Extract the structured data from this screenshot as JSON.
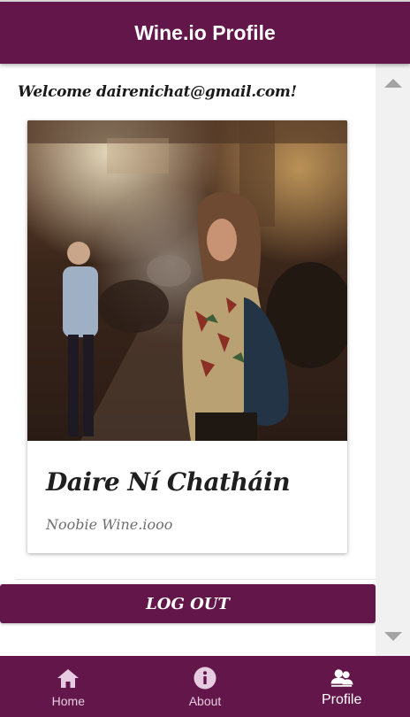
{
  "app_bar": {
    "title": "Wine.io Profile"
  },
  "welcome": {
    "text": "Welcome dairenichat@gmail.com!"
  },
  "profile_card": {
    "name": "Daire Ní Chatháin",
    "rank": "Noobie Wine.iooo"
  },
  "actions": {
    "logout_label": "LOG OUT"
  },
  "bottom_nav": {
    "items": [
      {
        "label": "Home",
        "icon": "home-icon",
        "active": false
      },
      {
        "label": "About",
        "icon": "info-icon",
        "active": false
      },
      {
        "label": "Profile",
        "icon": "people-icon",
        "active": true
      }
    ]
  },
  "colors": {
    "primary": "#63164a",
    "nav_inactive_text": "#e7cbe0",
    "background": "#ffffff",
    "scroll_track": "#f1f1f1"
  }
}
